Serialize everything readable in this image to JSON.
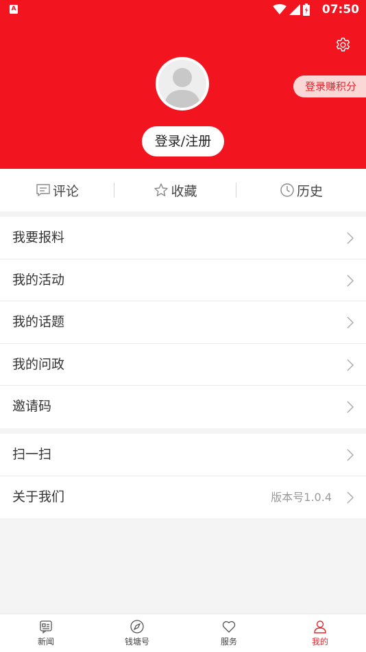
{
  "status_bar": {
    "app_icon_letter": "A",
    "time": "07:50"
  },
  "header": {
    "earn_points_label": "登录赚积分",
    "login_label": "登录/注册"
  },
  "tabs": [
    {
      "label": "评论",
      "icon": "comment-icon"
    },
    {
      "label": "收藏",
      "icon": "star-icon"
    },
    {
      "label": "历史",
      "icon": "clock-icon"
    }
  ],
  "menu_group_1": [
    {
      "label": "我要报料"
    },
    {
      "label": "我的活动"
    },
    {
      "label": "我的话题"
    },
    {
      "label": "我的问政"
    },
    {
      "label": "邀请码"
    }
  ],
  "menu_group_2": [
    {
      "label": "扫一扫"
    },
    {
      "label": "关于我们",
      "value": "版本号1.0.4"
    }
  ],
  "bottom_nav": [
    {
      "label": "新闻",
      "icon": "news-icon"
    },
    {
      "label": "钱塘号",
      "icon": "compass-icon"
    },
    {
      "label": "服务",
      "icon": "heart-icon"
    },
    {
      "label": "我的",
      "icon": "person-icon",
      "active": true
    }
  ],
  "colors": {
    "brand_red": "#f2141f",
    "active_red": "#e8262d"
  }
}
